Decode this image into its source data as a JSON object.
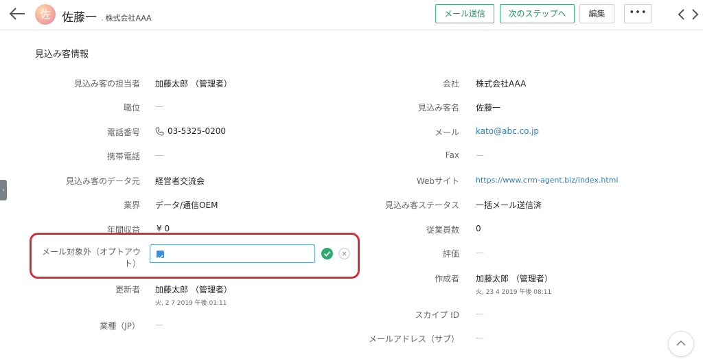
{
  "header": {
    "avatar_initial": "佐",
    "lead_name": "佐藤一",
    "company": "株式会社AAA",
    "buttons": {
      "send_mail": "メール送信",
      "next_step": "次のステップへ",
      "edit": "編集",
      "more": "•••"
    }
  },
  "section_title": "見込み客情報",
  "left_fields": {
    "owner": {
      "label": "見込み客の担当者",
      "value": "加藤太郎 （管理者）"
    },
    "title": {
      "label": "職位",
      "value": "—"
    },
    "phone": {
      "label": "電話番号",
      "value": "03-5325-0200"
    },
    "mobile": {
      "label": "携帯電話",
      "value": "—"
    },
    "source": {
      "label": "見込み客のデータ元",
      "value": "経営者交流会"
    },
    "industry": {
      "label": "業界",
      "value": "データ/通信OEM"
    },
    "revenue": {
      "label": "年間収益",
      "value": "¥ 0"
    },
    "opt_out": {
      "label": "メール対象外（オプトアウト）",
      "checked": true
    },
    "modified_by": {
      "label": "更新者",
      "value": "加藤太郎 （管理者）",
      "time": "火, 2 7 2019 午後 01:11"
    },
    "industry_jp": {
      "label": "業種（JP）",
      "value": "—"
    }
  },
  "right_fields": {
    "company": {
      "label": "会社",
      "value": "株式会社AAA"
    },
    "lead_name": {
      "label": "見込み客名",
      "value": "佐藤一"
    },
    "email": {
      "label": "メール",
      "value": "kato@abc.co.jp"
    },
    "fax": {
      "label": "Fax",
      "value": "—"
    },
    "website": {
      "label": "Webサイト",
      "value": "https://www.crm-agent.biz/index.html"
    },
    "status": {
      "label": "見込み客ステータス",
      "value": "一括メール送信済"
    },
    "employees": {
      "label": "従業員数",
      "value": "0"
    },
    "rating": {
      "label": "評価",
      "value": "—"
    },
    "created_by": {
      "label": "作成者",
      "value": "加藤太郎 （管理者）",
      "time": "火, 23 4 2019 午後 08:11"
    },
    "skype": {
      "label": "スカイプ ID",
      "value": "—"
    },
    "secondary_email": {
      "label": "メールアドレス（サブ）",
      "value": "—"
    }
  },
  "colors": {
    "accent_green": "#3bb37e",
    "link_blue": "#2f7fc1",
    "highlight_red": "#d72d38"
  }
}
